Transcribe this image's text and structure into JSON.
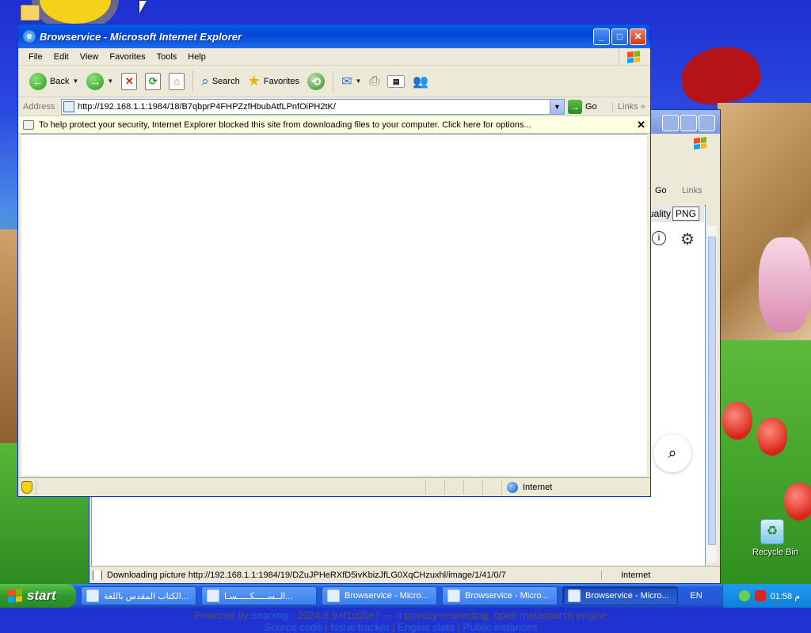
{
  "desktop": {
    "recycle_bin_label": "Recycle Bin"
  },
  "background_window": {
    "go_label": "Go",
    "links_label": "Links",
    "quality_label": "uality",
    "quality_value": "PNG",
    "footer_powered": "Powered by",
    "footer_engine": "searxng",
    "footer_version": "- 2024.8.9+f1c05e7 — a privacy-respecting, open metasearch engine",
    "footer_links": [
      "Source code",
      "Issue tracker",
      "Engine stats",
      "Public instances"
    ],
    "status_text": "Downloading picture http://192.168.1.1:1984/19/DZuJPHeRXfD5ivKbizJfLG0XqCHzuxhl/image/1/41/0/7",
    "status_zone": "Internet"
  },
  "window": {
    "title": "Browservice - Microsoft Internet Explorer",
    "menu": [
      "File",
      "Edit",
      "View",
      "Favorites",
      "Tools",
      "Help"
    ],
    "toolbar": {
      "back": "Back",
      "search": "Search",
      "favorites": "Favorites"
    },
    "address": {
      "label": "Address",
      "url": "http://192.168.1.1:1984/18/B7qbprP4FHPZzfHbubAtfLPnfOiPH2tK/",
      "go": "Go",
      "links": "Links"
    },
    "infobar": "To help protect your security, Internet Explorer blocked this site from downloading files to your computer. Click here for options...",
    "status_zone": "Internet"
  },
  "taskbar": {
    "start": "start",
    "tasks": [
      "الكتاب المقدس باللغة...",
      "الــســـــكـــــسـا...",
      "Browservice - Micro...",
      "Browservice - Micro...",
      "Browservice - Micro..."
    ],
    "language": "EN",
    "clock": "01:58 م"
  }
}
